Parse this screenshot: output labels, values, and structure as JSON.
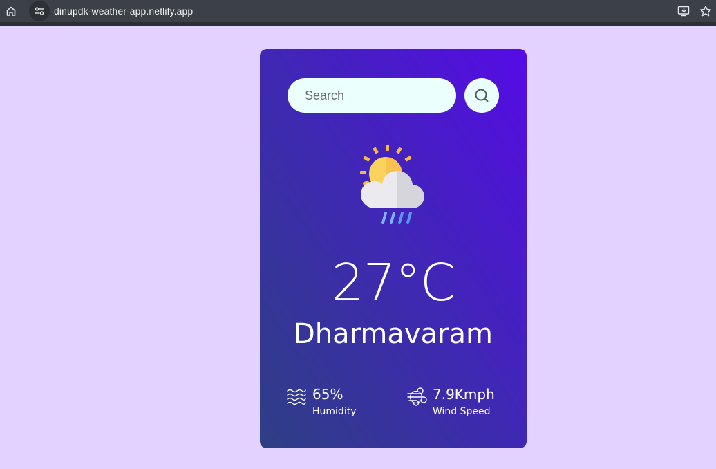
{
  "browser": {
    "url": "dinupdk-weather-app.netlify.app",
    "icons": [
      "home-icon",
      "site-info-icon",
      "install-app-icon",
      "bookmark-star-icon"
    ]
  },
  "weather": {
    "search": {
      "placeholder": "Search",
      "value": ""
    },
    "condition_icon": "sun-cloud-rain-icon",
    "temperature": "27°C",
    "city": "Dharmavaram",
    "humidity": {
      "value": "65%",
      "label": "Humidity",
      "icon": "humidity-waves-icon"
    },
    "wind": {
      "value": "7.9Kmph",
      "label": "Wind Speed",
      "icon": "wind-icon"
    }
  },
  "colors": {
    "page_background": "#e3d2ff",
    "card_gradient_start": "#2e3f84",
    "card_gradient_end": "#560be6",
    "search_background": "#ebfffc",
    "text": "#ffffff"
  }
}
